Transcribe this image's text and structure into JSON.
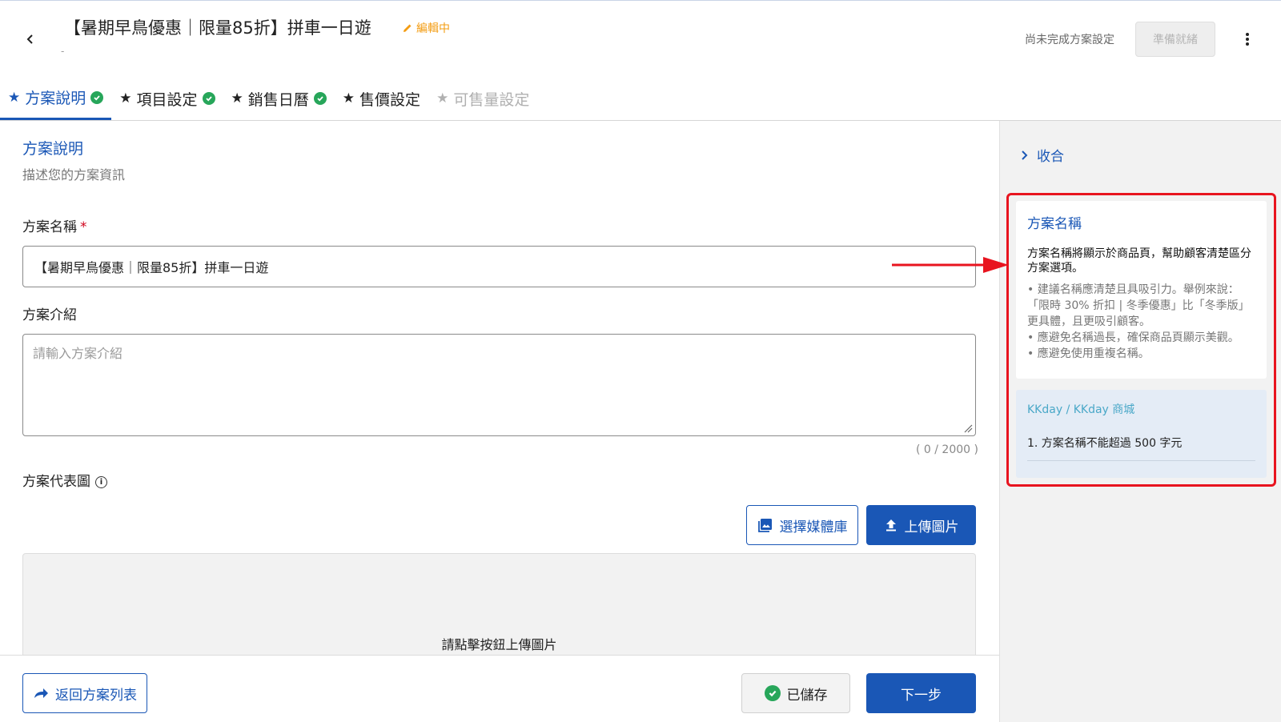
{
  "header": {
    "title": "【暑期早鳥優惠｜限量85折】拼車一日遊",
    "editing_label": "編輯中",
    "sub_marker": "-",
    "status_text": "尚未完成方案設定",
    "ready_button": "準備就緒"
  },
  "tabs": [
    {
      "label": "方案說明",
      "state": "active",
      "completed": true
    },
    {
      "label": "項目設定",
      "state": "normal",
      "completed": true
    },
    {
      "label": "銷售日曆",
      "state": "normal",
      "completed": true
    },
    {
      "label": "售價設定",
      "state": "normal",
      "completed": false
    },
    {
      "label": "可售量設定",
      "state": "disabled",
      "completed": false
    }
  ],
  "main": {
    "section_title": "方案說明",
    "section_subtitle": "描述您的方案資訊",
    "name_label": "方案名稱",
    "required_mark": "*",
    "name_value": "【暑期早鳥優惠｜限量85折】拼車一日遊",
    "intro_label": "方案介紹",
    "intro_placeholder": "請輸入方案介紹",
    "intro_counter": "( 0 / 2000 )",
    "image_label": "方案代表圖",
    "info_glyph": "i",
    "media_button": "選擇媒體庫",
    "upload_button": "上傳圖片",
    "upload_hint": "請點擊按鈕上傳圖片"
  },
  "footer": {
    "back_button": "返回方案列表",
    "saved_button": "已儲存",
    "next_button": "下一步"
  },
  "side": {
    "collapse_label": "收合",
    "help_title": "方案名稱",
    "help_lead": "方案名稱將顯示於商品頁，幫助顧客清楚區分方案選項。",
    "help_bullets": [
      "• 建議名稱應清楚且具吸引力。舉例來說：「限時 30% 折扣 | 冬季優惠」比「冬季版」更具體，且更吸引顧客。",
      "• 應避免名稱過長，確保商品頁顯示美觀。",
      "• 應避免使用重複名稱。"
    ],
    "kk_title": "KKday / KKday 商城",
    "kk_rule": "1. 方案名稱不能超過 500 字元"
  },
  "colors": {
    "brand_blue": "#1a57b6",
    "success_green": "#27a65a",
    "editing_orange": "#f39c12",
    "highlight_red": "#e8141f"
  },
  "icons": {
    "back": "chevron-left-icon",
    "edit": "pencil-icon",
    "more": "more-vertical-icon",
    "tab_star": "star-icon",
    "tab_done": "check-circle-icon",
    "info": "info-icon",
    "media": "image-library-icon",
    "upload": "upload-icon",
    "back_list": "share-arrow-icon",
    "saved": "check-circle-icon",
    "collapse": "chevron-right-icon"
  }
}
